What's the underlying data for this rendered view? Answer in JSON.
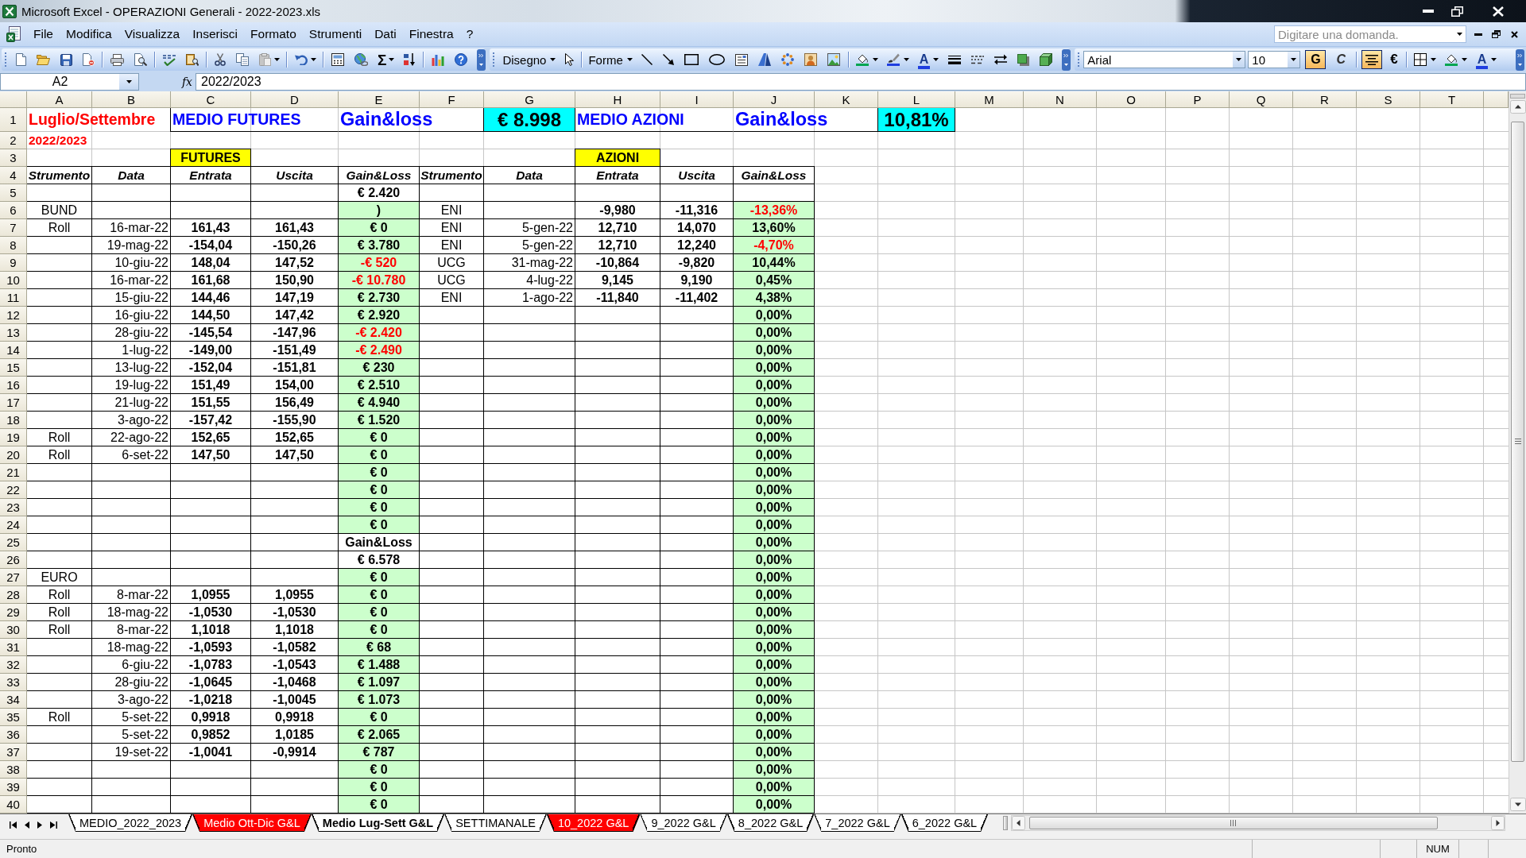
{
  "window": {
    "title": "Microsoft Excel - OPERAZIONI Generali - 2022-2023.xls"
  },
  "menu_bar": {
    "items": [
      "File",
      "Modifica",
      "Visualizza",
      "Inserisci",
      "Formato",
      "Strumenti",
      "Dati",
      "Finestra",
      "?"
    ],
    "question_box": {
      "placeholder": "Digitare una domanda."
    }
  },
  "toolbar": {
    "autosum": "Σ",
    "drawing_menus": [
      "Disegno",
      "Forme"
    ],
    "drawing_font_color": "A",
    "font_name": "Arial",
    "font_size": "10",
    "bold": {
      "label": "G",
      "on": true
    },
    "italic": {
      "label": "C",
      "on": false
    },
    "center_align": {
      "on": true
    },
    "currency": "€",
    "font_color": "A"
  },
  "formula_bar": {
    "name_box": "A2",
    "function_label": "fx",
    "value": "2022/2023"
  },
  "sheet": {
    "columns": [
      "A",
      "B",
      "C",
      "D",
      "E",
      "F",
      "G",
      "H",
      "I",
      "J",
      "K",
      "L",
      "M",
      "N",
      "O",
      "P",
      "Q",
      "R",
      "S",
      "T"
    ],
    "row_numbers": [
      "1",
      "2",
      "3",
      "4",
      "5",
      "6",
      "7",
      "8",
      "9",
      "10",
      "11",
      "12",
      "13",
      "14",
      "15",
      "16",
      "17",
      "18",
      "19",
      "20",
      "21",
      "22",
      "23",
      "24",
      "25",
      "26",
      "27",
      "28",
      "29",
      "30",
      "31",
      "32",
      "33",
      "34",
      "35",
      "36",
      "37",
      "38",
      "39",
      "40"
    ],
    "heading": {
      "period": "Luglio/Settembre",
      "year": "2022/2023"
    },
    "summaries": [
      {
        "label": "MEDIO FUTURES",
        "metric": "Gain&loss",
        "total": "€ 8.998"
      },
      {
        "label": "MEDIO AZIONI",
        "metric": "Gain&loss",
        "total": "10,81%"
      }
    ],
    "tables": [
      {
        "title": "FUTURES",
        "headers": [
          "Strumento",
          "Data",
          "Entrata",
          "Uscita",
          "Gain&Loss"
        ]
      },
      {
        "title": "AZIONI",
        "headers": [
          "Strumento",
          "Data",
          "Entrata",
          "Uscita",
          "Gain&Loss"
        ]
      }
    ],
    "data_rows": [
      {
        "futures": {
          "gain_loss": "€ 2.420",
          "negative": false,
          "filled": false
        }
      },
      {
        "futures": {
          "strumento": "BUND",
          "gain_loss": ")",
          "negative": false,
          "filled": true
        },
        "azioni": {
          "strumento": "ENI",
          "entrata": "-9,980",
          "uscita": "-11,316",
          "gain_loss": "-13,36%",
          "negative": true,
          "filled": true
        }
      },
      {
        "futures": {
          "strumento": "Roll",
          "data": "16-mar-22",
          "entrata": "161,43",
          "uscita": "161,43",
          "gain_loss": "€ 0",
          "negative": false,
          "filled": true
        },
        "azioni": {
          "strumento": "ENI",
          "data": "5-gen-22",
          "entrata": "12,710",
          "uscita": "14,070",
          "gain_loss": "13,60%",
          "negative": false,
          "filled": true
        }
      },
      {
        "futures": {
          "data": "19-mag-22",
          "entrata": "-154,04",
          "uscita": "-150,26",
          "gain_loss": "€ 3.780",
          "negative": false,
          "filled": true
        },
        "azioni": {
          "strumento": "ENI",
          "data": "5-gen-22",
          "entrata": "12,710",
          "uscita": "12,240",
          "gain_loss": "-4,70%",
          "negative": true,
          "filled": true
        }
      },
      {
        "futures": {
          "data": "10-giu-22",
          "entrata": "148,04",
          "uscita": "147,52",
          "gain_loss": "-€ 520",
          "negative": true,
          "filled": true
        },
        "azioni": {
          "strumento": "UCG",
          "data": "31-mag-22",
          "entrata": "-10,864",
          "uscita": "-9,820",
          "gain_loss": "10,44%",
          "negative": false,
          "filled": true
        }
      },
      {
        "futures": {
          "data": "16-mar-22",
          "entrata": "161,68",
          "uscita": "150,90",
          "gain_loss": "-€ 10.780",
          "negative": true,
          "filled": true
        },
        "azioni": {
          "strumento": "UCG",
          "data": "4-lug-22",
          "entrata": "9,145",
          "uscita": "9,190",
          "gain_loss": "0,45%",
          "negative": false,
          "filled": true
        }
      },
      {
        "futures": {
          "data": "15-giu-22",
          "entrata": "144,46",
          "uscita": "147,19",
          "gain_loss": "€ 2.730",
          "negative": false,
          "filled": true
        },
        "azioni": {
          "strumento": "ENI",
          "data": "1-ago-22",
          "entrata": "-11,840",
          "uscita": "-11,402",
          "gain_loss": "4,38%",
          "negative": false,
          "filled": true
        }
      },
      {
        "futures": {
          "data": "16-giu-22",
          "entrata": "144,50",
          "uscita": "147,42",
          "gain_loss": "€ 2.920",
          "negative": false,
          "filled": true
        },
        "azioni": {
          "gain_loss": "0,00%",
          "negative": false,
          "filled": true
        }
      },
      {
        "futures": {
          "data": "28-giu-22",
          "entrata": "-145,54",
          "uscita": "-147,96",
          "gain_loss": "-€ 2.420",
          "negative": true,
          "filled": true
        },
        "azioni": {
          "gain_loss": "0,00%",
          "negative": false,
          "filled": true
        }
      },
      {
        "futures": {
          "data": "1-lug-22",
          "entrata": "-149,00",
          "uscita": "-151,49",
          "gain_loss": "-€ 2.490",
          "negative": true,
          "filled": true
        },
        "azioni": {
          "gain_loss": "0,00%",
          "negative": false,
          "filled": true
        }
      },
      {
        "futures": {
          "data": "13-lug-22",
          "entrata": "-152,04",
          "uscita": "-151,81",
          "gain_loss": "€ 230",
          "negative": false,
          "filled": true
        },
        "azioni": {
          "gain_loss": "0,00%",
          "negative": false,
          "filled": true
        }
      },
      {
        "futures": {
          "data": "19-lug-22",
          "entrata": "151,49",
          "uscita": "154,00",
          "gain_loss": "€ 2.510",
          "negative": false,
          "filled": true
        },
        "azioni": {
          "gain_loss": "0,00%",
          "negative": false,
          "filled": true
        }
      },
      {
        "futures": {
          "data": "21-lug-22",
          "entrata": "151,55",
          "uscita": "156,49",
          "gain_loss": "€ 4.940",
          "negative": false,
          "filled": true
        },
        "azioni": {
          "gain_loss": "0,00%",
          "negative": false,
          "filled": true
        }
      },
      {
        "futures": {
          "data": "3-ago-22",
          "entrata": "-157,42",
          "uscita": "-155,90",
          "gain_loss": "€ 1.520",
          "negative": false,
          "filled": true
        },
        "azioni": {
          "gain_loss": "0,00%",
          "negative": false,
          "filled": true
        }
      },
      {
        "futures": {
          "strumento": "Roll",
          "data": "22-ago-22",
          "entrata": "152,65",
          "uscita": "152,65",
          "gain_loss": "€ 0",
          "negative": false,
          "filled": true
        },
        "azioni": {
          "gain_loss": "0,00%",
          "negative": false,
          "filled": true
        }
      },
      {
        "futures": {
          "strumento": "Roll",
          "data": "6-set-22",
          "entrata": "147,50",
          "uscita": "147,50",
          "gain_loss": "€ 0",
          "negative": false,
          "filled": true
        },
        "azioni": {
          "gain_loss": "0,00%",
          "negative": false,
          "filled": true
        }
      },
      {
        "futures": {
          "gain_loss": "€ 0",
          "negative": false,
          "filled": true
        },
        "azioni": {
          "gain_loss": "0,00%",
          "negative": false,
          "filled": true
        }
      },
      {
        "futures": {
          "gain_loss": "€ 0",
          "negative": false,
          "filled": true
        },
        "azioni": {
          "gain_loss": "0,00%",
          "negative": false,
          "filled": true
        }
      },
      {
        "futures": {
          "gain_loss": "€ 0",
          "negative": false,
          "filled": true
        },
        "azioni": {
          "gain_loss": "0,00%",
          "negative": false,
          "filled": true
        }
      },
      {
        "futures": {
          "gain_loss": "€ 0",
          "negative": false,
          "filled": true
        },
        "azioni": {
          "gain_loss": "0,00%",
          "negative": false,
          "filled": true
        }
      },
      {
        "futures": {
          "gain_loss": "Gain&Loss",
          "negative": false,
          "filled": false
        },
        "azioni": {
          "gain_loss": "0,00%",
          "negative": false,
          "filled": true
        }
      },
      {
        "futures": {
          "gain_loss": "€ 6.578",
          "negative": false,
          "filled": false
        },
        "azioni": {
          "gain_loss": "0,00%",
          "negative": false,
          "filled": true
        }
      },
      {
        "futures": {
          "strumento": "EURO",
          "gain_loss": "€ 0",
          "negative": false,
          "filled": true
        },
        "azioni": {
          "gain_loss": "0,00%",
          "negative": false,
          "filled": true
        }
      },
      {
        "futures": {
          "strumento": "Roll",
          "data": "8-mar-22",
          "entrata": "1,0955",
          "uscita": "1,0955",
          "gain_loss": "€ 0",
          "negative": false,
          "filled": true
        },
        "azioni": {
          "gain_loss": "0,00%",
          "negative": false,
          "filled": true
        }
      },
      {
        "futures": {
          "strumento": "Roll",
          "data": "18-mag-22",
          "entrata": "-1,0530",
          "uscita": "-1,0530",
          "gain_loss": "€ 0",
          "negative": false,
          "filled": true
        },
        "azioni": {
          "gain_loss": "0,00%",
          "negative": false,
          "filled": true
        }
      },
      {
        "futures": {
          "strumento": "Roll",
          "data": "8-mar-22",
          "entrata": "1,1018",
          "uscita": "1,1018",
          "gain_loss": "€ 0",
          "negative": false,
          "filled": true
        },
        "azioni": {
          "gain_loss": "0,00%",
          "negative": false,
          "filled": true
        }
      },
      {
        "futures": {
          "data": "18-mag-22",
          "entrata": "-1,0593",
          "uscita": "-1,0582",
          "gain_loss": "€ 68",
          "negative": false,
          "filled": true
        },
        "azioni": {
          "gain_loss": "0,00%",
          "negative": false,
          "filled": true
        }
      },
      {
        "futures": {
          "data": "6-giu-22",
          "entrata": "-1,0783",
          "uscita": "-1,0543",
          "gain_loss": "€ 1.488",
          "negative": false,
          "filled": true
        },
        "azioni": {
          "gain_loss": "0,00%",
          "negative": false,
          "filled": true
        }
      },
      {
        "futures": {
          "data": "28-giu-22",
          "entrata": "-1,0645",
          "uscita": "-1,0468",
          "gain_loss": "€ 1.097",
          "negative": false,
          "filled": true
        },
        "azioni": {
          "gain_loss": "0,00%",
          "negative": false,
          "filled": true
        }
      },
      {
        "futures": {
          "data": "3-ago-22",
          "entrata": "-1,0218",
          "uscita": "-1,0045",
          "gain_loss": "€ 1.073",
          "negative": false,
          "filled": true
        },
        "azioni": {
          "gain_loss": "0,00%",
          "negative": false,
          "filled": true
        }
      },
      {
        "futures": {
          "strumento": "Roll",
          "data": "5-set-22",
          "entrata": "0,9918",
          "uscita": "0,9918",
          "gain_loss": "€ 0",
          "negative": false,
          "filled": true
        },
        "azioni": {
          "gain_loss": "0,00%",
          "negative": false,
          "filled": true
        }
      },
      {
        "futures": {
          "data": "5-set-22",
          "entrata": "0,9852",
          "uscita": "1,0185",
          "gain_loss": "€ 2.065",
          "negative": false,
          "filled": true
        },
        "azioni": {
          "gain_loss": "0,00%",
          "negative": false,
          "filled": true
        }
      },
      {
        "futures": {
          "data": "19-set-22",
          "entrata": "-1,0041",
          "uscita": "-0,9914",
          "gain_loss": "€ 787",
          "negative": false,
          "filled": true
        },
        "azioni": {
          "gain_loss": "0,00%",
          "negative": false,
          "filled": true
        }
      },
      {
        "futures": {
          "gain_loss": "€ 0",
          "negative": false,
          "filled": true
        },
        "azioni": {
          "gain_loss": "0,00%",
          "negative": false,
          "filled": true
        }
      },
      {
        "futures": {
          "gain_loss": "€ 0",
          "negative": false,
          "filled": true
        },
        "azioni": {
          "gain_loss": "0,00%",
          "negative": false,
          "filled": true
        }
      },
      {
        "futures": {
          "gain_loss": "€ 0",
          "negative": false,
          "filled": true
        },
        "azioni": {
          "gain_loss": "0,00%",
          "negative": false,
          "filled": true
        }
      }
    ]
  },
  "sheet_tabs": [
    {
      "label": "MEDIO_2022_2023",
      "selected": false,
      "color": "#ffffff"
    },
    {
      "label": "Medio Ott-Dic G&L",
      "selected": false,
      "color": "#ff0000"
    },
    {
      "label": "Medio Lug-Sett G&L",
      "selected": true,
      "color": "#ffffff"
    },
    {
      "label": "SETTIMANALE",
      "selected": false,
      "color": "#ffffff"
    },
    {
      "label": "10_2022 G&L",
      "selected": false,
      "color": "#ff0000"
    },
    {
      "label": "9_2022 G&L",
      "selected": false,
      "color": "#ffffff"
    },
    {
      "label": "8_2022 G&L",
      "selected": false,
      "color": "#ffffff"
    },
    {
      "label": "7_2022 G&L",
      "selected": false,
      "color": "#ffffff"
    },
    {
      "label": "6_2022 G&L",
      "selected": false,
      "color": "#ffffff"
    }
  ],
  "status_bar": {
    "message": "Pronto",
    "indicators": [
      "NUM"
    ]
  }
}
